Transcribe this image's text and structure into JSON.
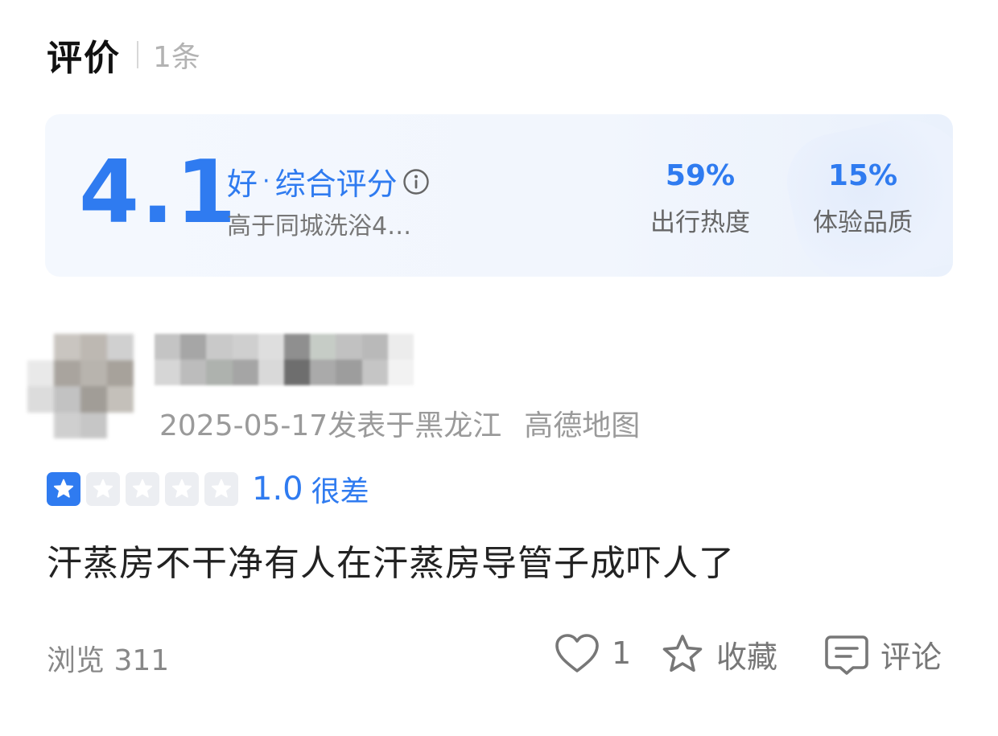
{
  "header": {
    "title": "评价",
    "count": "1条"
  },
  "score": {
    "value": "4.1",
    "level": "好",
    "separator": "·",
    "label": "综合评分",
    "compare": "高于同城洗浴4…",
    "info_icon": "info-icon",
    "stats": [
      {
        "value": "59%",
        "label": "出行热度"
      },
      {
        "value": "15%",
        "label": "体验品质"
      }
    ]
  },
  "review": {
    "date_location": "2025-05-17发表于黑龙江",
    "source": "高德地图",
    "rating_value": "1.0",
    "rating_text": "很差",
    "stars_filled": 1,
    "stars_total": 5,
    "content": "汗蒸房不干净有人在汗蒸房导管子成吓人了"
  },
  "footer": {
    "views": "浏览 311",
    "like_count": "1",
    "favorite_label": "收藏",
    "comment_label": "评论"
  },
  "colors": {
    "accent": "#2f7bf0",
    "muted": "#9a9a9a"
  }
}
